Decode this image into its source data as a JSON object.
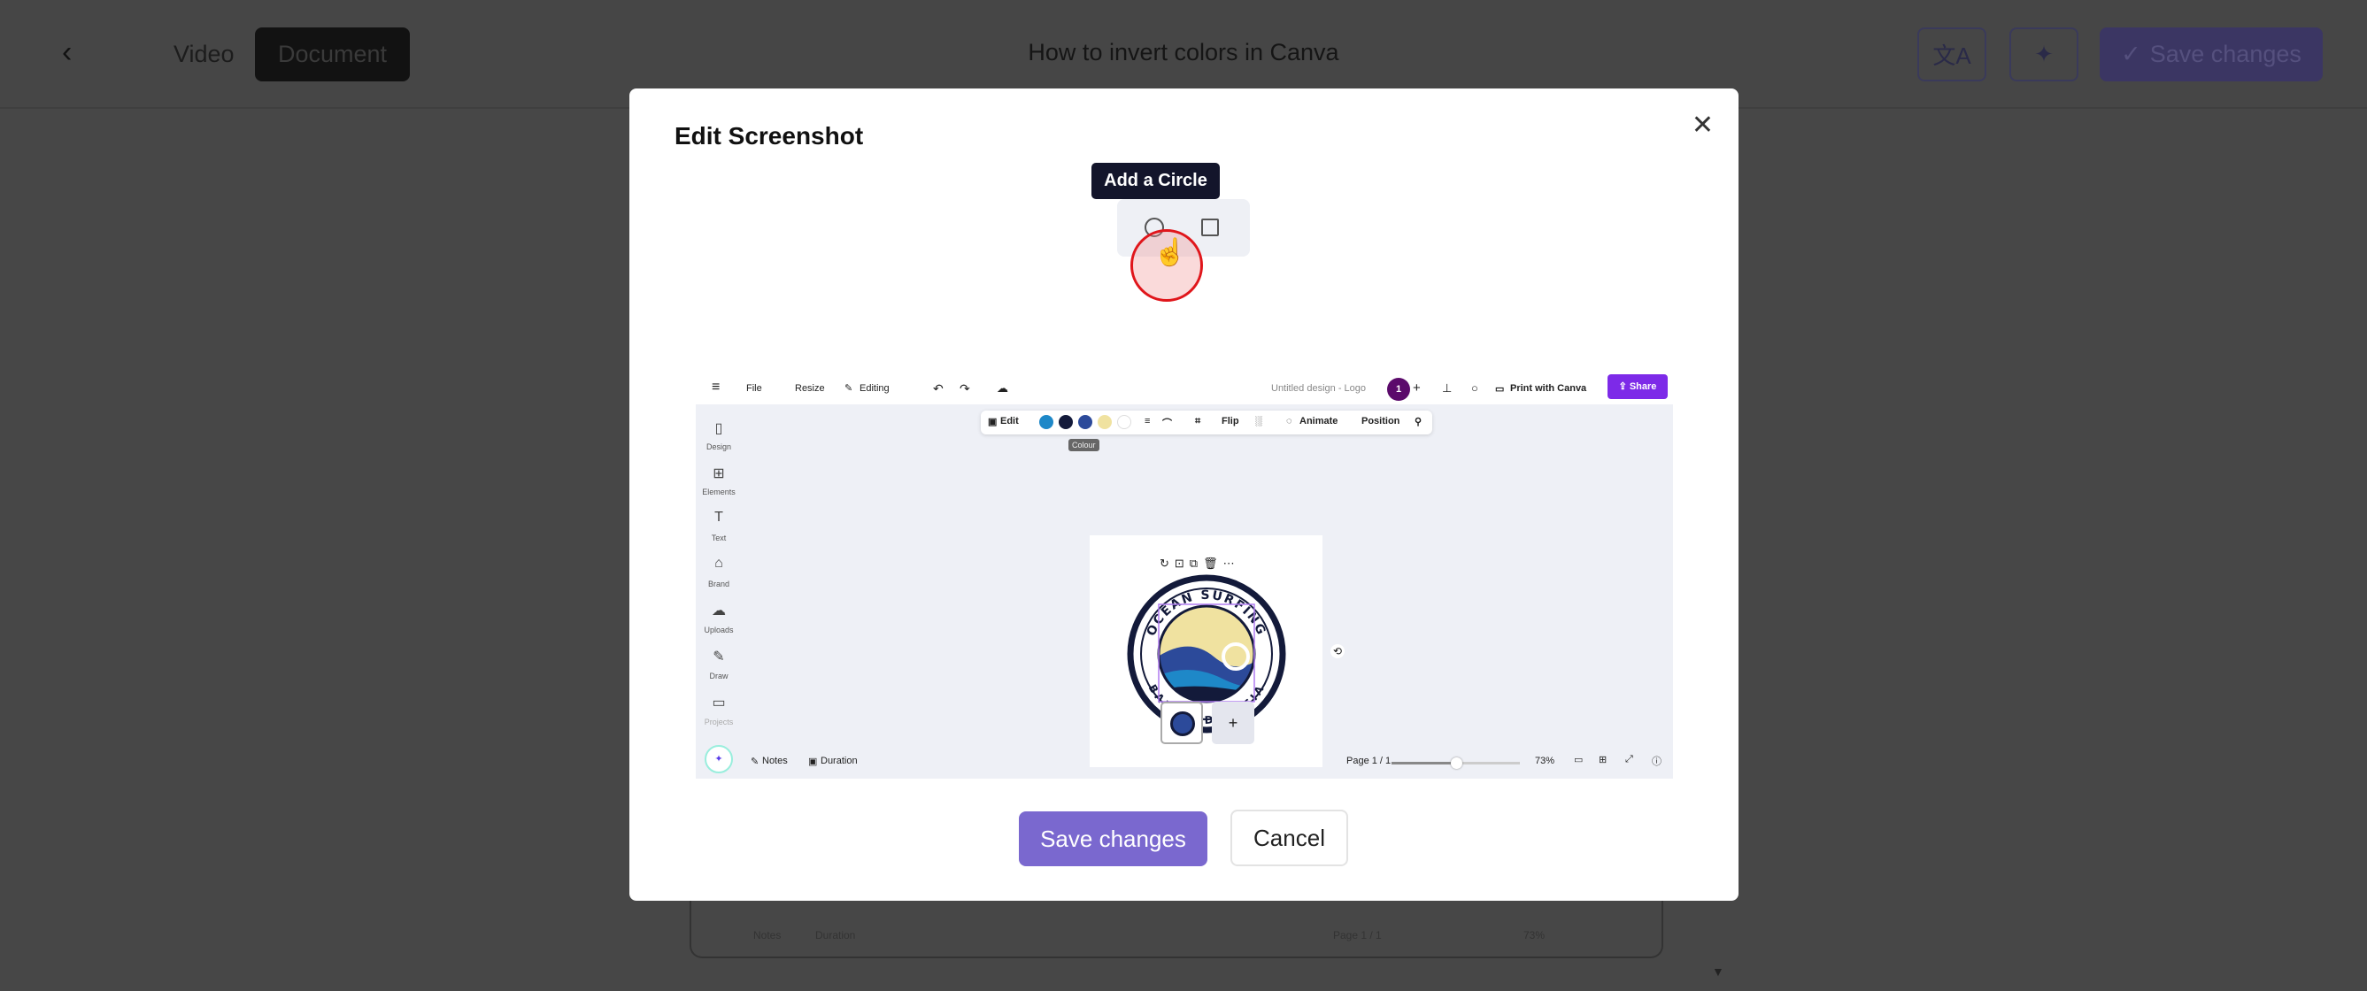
{
  "header": {
    "back_icon": "chevron-left-icon",
    "tabs": [
      {
        "label": "Video",
        "active": false
      },
      {
        "label": "Document",
        "active": true
      }
    ],
    "title": "How to invert colors in Canva",
    "translate_icon": "translate-icon",
    "magic_icon": "magic-wand-icon",
    "save_label": "Save changes",
    "save_icon": "check-icon"
  },
  "modal": {
    "title": "Edit Screenshot",
    "close_icon": "close-icon",
    "tooltip": "Add a Circle",
    "tools": [
      "circle-tool-icon",
      "square-tool-icon"
    ],
    "save_label": "Save changes",
    "cancel_label": "Cancel",
    "annotation_color": "#e0161b",
    "accent": "#7a68cf"
  },
  "canva": {
    "menu": [
      "File",
      "Resize",
      "Editing"
    ],
    "design_name": "Untitled design - Logo",
    "avatar": "1",
    "print_label": "Print with Canva",
    "share_label": "Share",
    "share_color": "#7d2ae8",
    "sidebar": [
      "Design",
      "Elements",
      "Text",
      "Brand",
      "Uploads",
      "Draw",
      "Projects"
    ],
    "toolbar": {
      "edit": "Edit",
      "colors": [
        "#1e88c8",
        "#131a3a",
        "#2c4a9a",
        "#f0e2a0",
        "#ffffff"
      ],
      "flip": "Flip",
      "animate": "Animate",
      "position": "Position",
      "tooltip": "Colour"
    },
    "logo": {
      "top_text": "OCEAN SURFING",
      "bottom_text": "BALI, INDONESIA"
    },
    "bottom": {
      "notes": "Notes",
      "duration": "Duration",
      "page": "Page 1 / 1",
      "zoom": "73%",
      "zoom_slider": 0.5
    }
  },
  "background": {
    "notes": "Notes",
    "duration": "Duration",
    "page": "Page 1 / 1",
    "zoom": "73%"
  }
}
